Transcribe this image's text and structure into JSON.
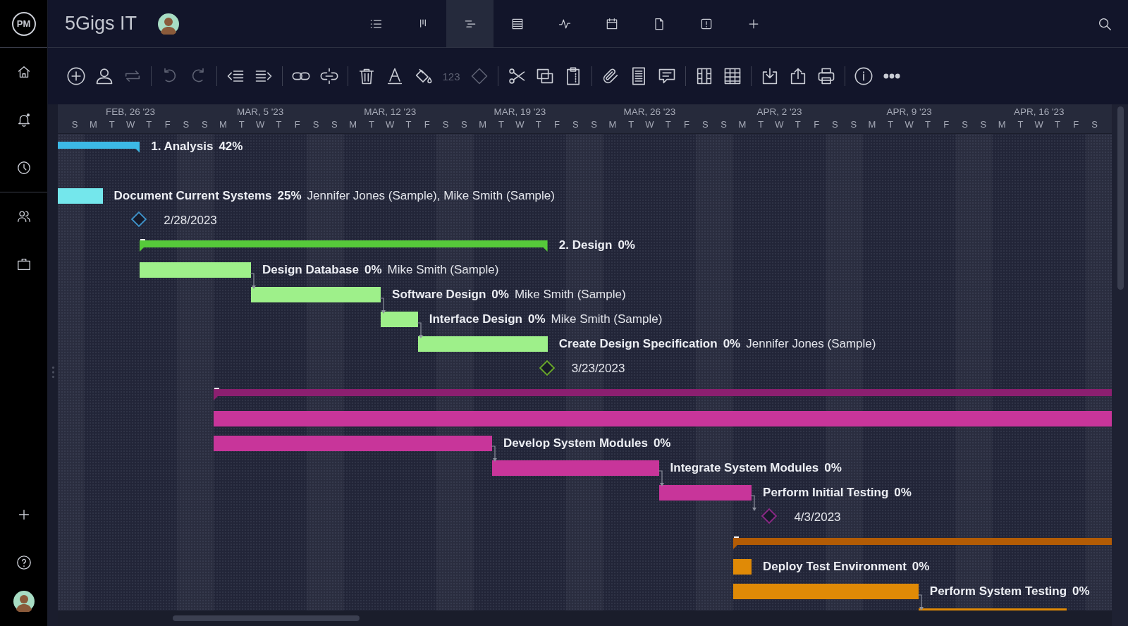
{
  "project": {
    "logo": "PM",
    "title": "5Gigs IT"
  },
  "views": [
    {
      "kind": "list",
      "selected": false
    },
    {
      "kind": "board",
      "selected": false
    },
    {
      "kind": "gantt",
      "selected": true
    },
    {
      "kind": "sheet",
      "selected": false
    },
    {
      "kind": "dashboard",
      "selected": false
    },
    {
      "kind": "calendar",
      "selected": false
    },
    {
      "kind": "files",
      "selected": false
    },
    {
      "kind": "risks",
      "selected": false
    },
    {
      "kind": "add",
      "selected": false
    }
  ],
  "toolbar": {
    "groups": [
      [
        {
          "kind": "add",
          "disabled": false
        },
        {
          "kind": "user",
          "disabled": false
        },
        {
          "kind": "recurring",
          "disabled": true
        }
      ],
      [
        {
          "kind": "undo",
          "disabled": true
        },
        {
          "kind": "redo",
          "disabled": true
        }
      ],
      [
        {
          "kind": "outdent",
          "disabled": false
        },
        {
          "kind": "indent",
          "disabled": false
        }
      ],
      [
        {
          "kind": "link",
          "disabled": false
        },
        {
          "kind": "unlink",
          "disabled": false
        }
      ],
      [
        {
          "kind": "delete",
          "disabled": false
        },
        {
          "kind": "textcolor",
          "disabled": false
        },
        {
          "kind": "fill",
          "disabled": false
        },
        {
          "kind": "number",
          "label": "123",
          "disabled": true
        },
        {
          "kind": "milestone",
          "disabled": true
        }
      ],
      [
        {
          "kind": "cut",
          "disabled": false
        },
        {
          "kind": "copy",
          "disabled": false
        },
        {
          "kind": "paste",
          "disabled": false
        }
      ],
      [
        {
          "kind": "attach",
          "disabled": false
        },
        {
          "kind": "notes",
          "disabled": false
        },
        {
          "kind": "comment",
          "disabled": false
        }
      ],
      [
        {
          "kind": "columns",
          "disabled": false
        },
        {
          "kind": "grid",
          "disabled": false
        }
      ],
      [
        {
          "kind": "import",
          "disabled": false
        },
        {
          "kind": "export",
          "disabled": false
        },
        {
          "kind": "print",
          "disabled": false
        }
      ],
      [
        {
          "kind": "info",
          "disabled": false
        },
        {
          "kind": "more",
          "disabled": false
        }
      ]
    ]
  },
  "timeline": {
    "weeks": [
      {
        "label": "FEB, 26 '23",
        "days": [
          "S",
          "M",
          "T",
          "W",
          "T",
          "F",
          "S"
        ]
      },
      {
        "label": "MAR, 5 '23",
        "days": [
          "S",
          "M",
          "T",
          "W",
          "T",
          "F",
          "S"
        ]
      },
      {
        "label": "MAR, 12 '23",
        "days": [
          "S",
          "M",
          "T",
          "W",
          "T",
          "F",
          "S"
        ]
      },
      {
        "label": "MAR, 19 '23",
        "days": [
          "S",
          "M",
          "T",
          "W",
          "T",
          "F",
          "S"
        ]
      },
      {
        "label": "MAR, 26 '23",
        "days": [
          "S",
          "M",
          "T",
          "W",
          "T",
          "F",
          "S"
        ]
      },
      {
        "label": "APR, 2 '23",
        "days": [
          "S",
          "M",
          "T",
          "W",
          "T",
          "F",
          "S"
        ]
      },
      {
        "label": "APR, 9 '23",
        "days": [
          "S",
          "M",
          "T",
          "W",
          "T",
          "F",
          "S"
        ]
      },
      {
        "label": "APR, 16 '23",
        "days": [
          "S",
          "M",
          "T",
          "W",
          "T",
          "F",
          "S"
        ]
      }
    ]
  },
  "chart": {
    "rows": [
      {
        "kind": "summary",
        "name": "1. Analysis",
        "percent": "42%",
        "color": "#3cb9e6"
      },
      {
        "kind": "blank"
      },
      {
        "kind": "task",
        "name": "Document Current Systems",
        "percent": "25%",
        "assignees": "Jennifer Jones (Sample), Mike Smith (Sample)",
        "color": "#74e7ec"
      },
      {
        "kind": "milestone",
        "label": "2/28/2023",
        "color": "#3f90c6"
      },
      {
        "kind": "summary",
        "name": "2. Design",
        "percent": "0%",
        "color": "#56c93a",
        "expanded": true
      },
      {
        "kind": "task",
        "name": "Design Database",
        "percent": "0%",
        "assignees": "Mike Smith (Sample)",
        "color": "#9ef08a"
      },
      {
        "kind": "task",
        "name": "Software Design",
        "percent": "0%",
        "assignees": "Mike Smith (Sample)",
        "color": "#9ef08a",
        "after": true
      },
      {
        "kind": "task",
        "name": "Interface Design",
        "percent": "0%",
        "assignees": "Mike Smith (Sample)",
        "color": "#9ef08a",
        "after": true
      },
      {
        "kind": "task",
        "name": "Create Design Specification",
        "percent": "0%",
        "assignees": "Jennifer Jones (Sample)",
        "color": "#9ef08a",
        "after": true
      },
      {
        "kind": "milestone",
        "label": "3/23/2023",
        "color": "#6aa82c"
      },
      {
        "kind": "summary",
        "color": "#8c1f70",
        "expanded": true
      },
      {
        "kind": "task",
        "color": "#c8359a"
      },
      {
        "kind": "task",
        "name": "Develop System Modules",
        "percent": "0%",
        "color": "#c8359a"
      },
      {
        "kind": "task",
        "name": "Integrate System Modules",
        "percent": "0%",
        "color": "#c8359a",
        "after": true
      },
      {
        "kind": "task",
        "name": "Perform Initial Testing",
        "percent": "0%",
        "color": "#c8359a",
        "after": true
      },
      {
        "kind": "milestone",
        "label": "4/3/2023",
        "color": "#8a2a86",
        "after": true
      },
      {
        "kind": "summary",
        "color": "#b35c05",
        "expanded": true
      },
      {
        "kind": "task",
        "name": "Deploy Test Environment",
        "percent": "0%",
        "color": "#e08a06"
      },
      {
        "kind": "task",
        "name": "Perform System Testing",
        "percent": "0%",
        "color": "#e08a06"
      },
      {
        "kind": "task",
        "color": "#e08a06",
        "after": true
      }
    ]
  }
}
